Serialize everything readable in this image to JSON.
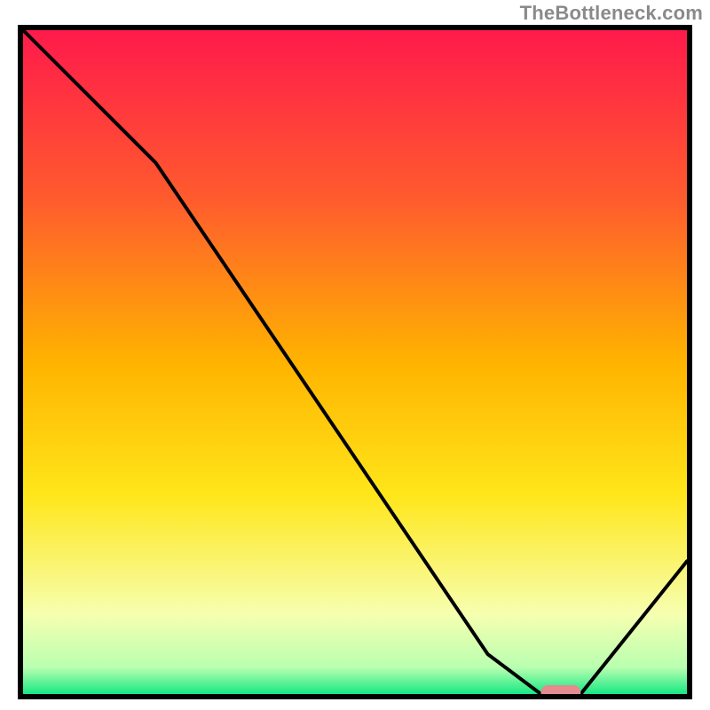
{
  "attribution": "TheBottleneck.com",
  "chart_data": {
    "type": "line",
    "title": "",
    "xlabel": "",
    "ylabel": "",
    "xlim": [
      0,
      100
    ],
    "ylim": [
      0,
      100
    ],
    "x": [
      0,
      20,
      70,
      78,
      84,
      100
    ],
    "values": [
      100,
      80,
      6,
      0,
      0,
      20
    ],
    "marker": {
      "x_start": 78,
      "x_end": 84,
      "y": 0,
      "color": "#e58a8f"
    },
    "gradient_stops": [
      {
        "offset": 0.0,
        "color": "#ff1a4b"
      },
      {
        "offset": 0.25,
        "color": "#ff5a2e"
      },
      {
        "offset": 0.5,
        "color": "#ffb300"
      },
      {
        "offset": 0.7,
        "color": "#ffe61a"
      },
      {
        "offset": 0.88,
        "color": "#f6ffb0"
      },
      {
        "offset": 0.96,
        "color": "#b9ffb0"
      },
      {
        "offset": 1.0,
        "color": "#17e884"
      }
    ],
    "frame_color": "#000000",
    "line_color": "#000000"
  }
}
